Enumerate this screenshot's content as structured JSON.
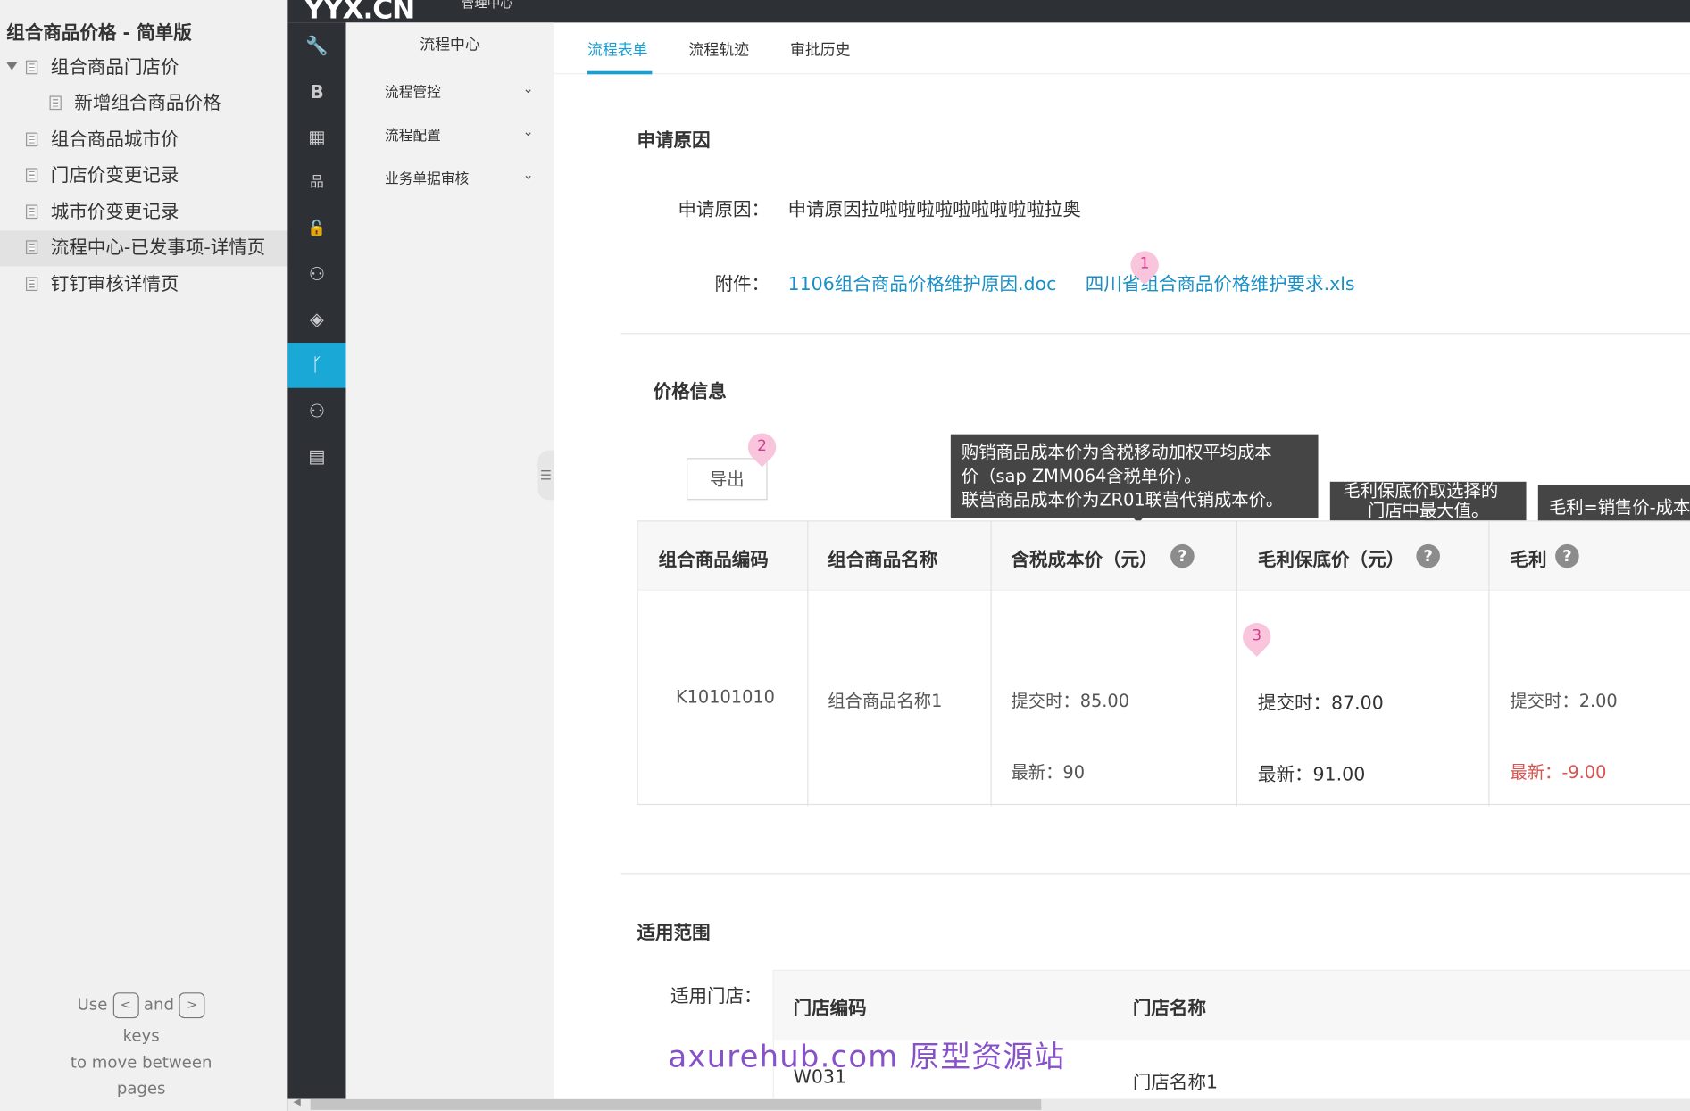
{
  "tree": {
    "title": "组合商品价格 - 简单版",
    "items": [
      {
        "label": "组合商品门店价"
      },
      {
        "label": "新增组合商品价格"
      },
      {
        "label": "组合商品城市价"
      },
      {
        "label": "门店价变更记录"
      },
      {
        "label": "城市价变更记录"
      },
      {
        "label": "流程中心-已发事项-详情页"
      },
      {
        "label": "钉钉审核详情页"
      }
    ],
    "help": {
      "use": "Use",
      "and": "and",
      "keys": "keys",
      "line1": "to move between",
      "line2": "pages",
      "prev_key": "<",
      "next_key": ">"
    }
  },
  "app": {
    "logo": "YYX.CN",
    "logo_sub": "管理中心"
  },
  "rail": {
    "icons": [
      "wrench-icon",
      "b-icon",
      "grid-icon",
      "org-icon",
      "lock-icon",
      "network-icon",
      "diamond-icon",
      "branch-icon",
      "network-icon-2",
      "store-icon"
    ],
    "glyphs": [
      "🔧",
      "B",
      "▦",
      "品",
      "🔓",
      "⚇",
      "◈",
      "ᚴ",
      "⚇",
      "▤"
    ]
  },
  "submenu": {
    "title": "流程中心",
    "items": [
      {
        "label": "流程管控"
      },
      {
        "label": "流程配置"
      },
      {
        "label": "业务单据审核"
      }
    ]
  },
  "tabs": [
    {
      "label": "流程表单"
    },
    {
      "label": "流程轨迹"
    },
    {
      "label": "审批历史"
    }
  ],
  "apply": {
    "section": "申请原因",
    "reason_label": "申请原因：",
    "reason_value": "申请原因拉啦啦啦啦啦啦啦啦啦拉奥",
    "attach_label": "附件：",
    "files": [
      "1106组合商品价格维护原因.doc",
      "四川省组合商品价格维护要求.xls"
    ]
  },
  "price": {
    "section": "价格信息",
    "export_button": "导出",
    "tooltips": {
      "cost": [
        "购销商品成本价为含税移动加权平均成本",
        "价（sap ZMM064含税单价）。",
        "联营商品成本价为ZR01联营代销成本价。"
      ],
      "floor": [
        "毛利保底价取选择的",
        "门店中最大值。"
      ],
      "margin": [
        "毛利=销售价-成本"
      ]
    },
    "headers": [
      "组合商品编码",
      "组合商品名称",
      "含税成本价（元）",
      "毛利保底价（元）",
      "毛利"
    ],
    "row": {
      "code": "K10101010",
      "name": "组合商品名称1",
      "cost_submit": "提交时：85.00",
      "cost_latest": "最新：90",
      "floor_submit": "提交时：87.00",
      "floor_latest": "最新：91.00",
      "margin_submit": "提交时：2.00",
      "margin_latest_label": "最新：",
      "margin_latest_value": "-9.00"
    }
  },
  "markers": [
    "1",
    "2",
    "3"
  ],
  "scope": {
    "section": "适用范围",
    "store_label": "适用门店：",
    "headers": [
      "门店编码",
      "门店名称"
    ],
    "row": {
      "code": "W031",
      "name": "门店名称1"
    }
  },
  "watermark": "axurehub.com 原型资源站",
  "colors": {
    "accent": "#1a9fd2",
    "sidebar": "#2d3035",
    "negative": "#d9534f",
    "marker": "#f8c5dc"
  }
}
